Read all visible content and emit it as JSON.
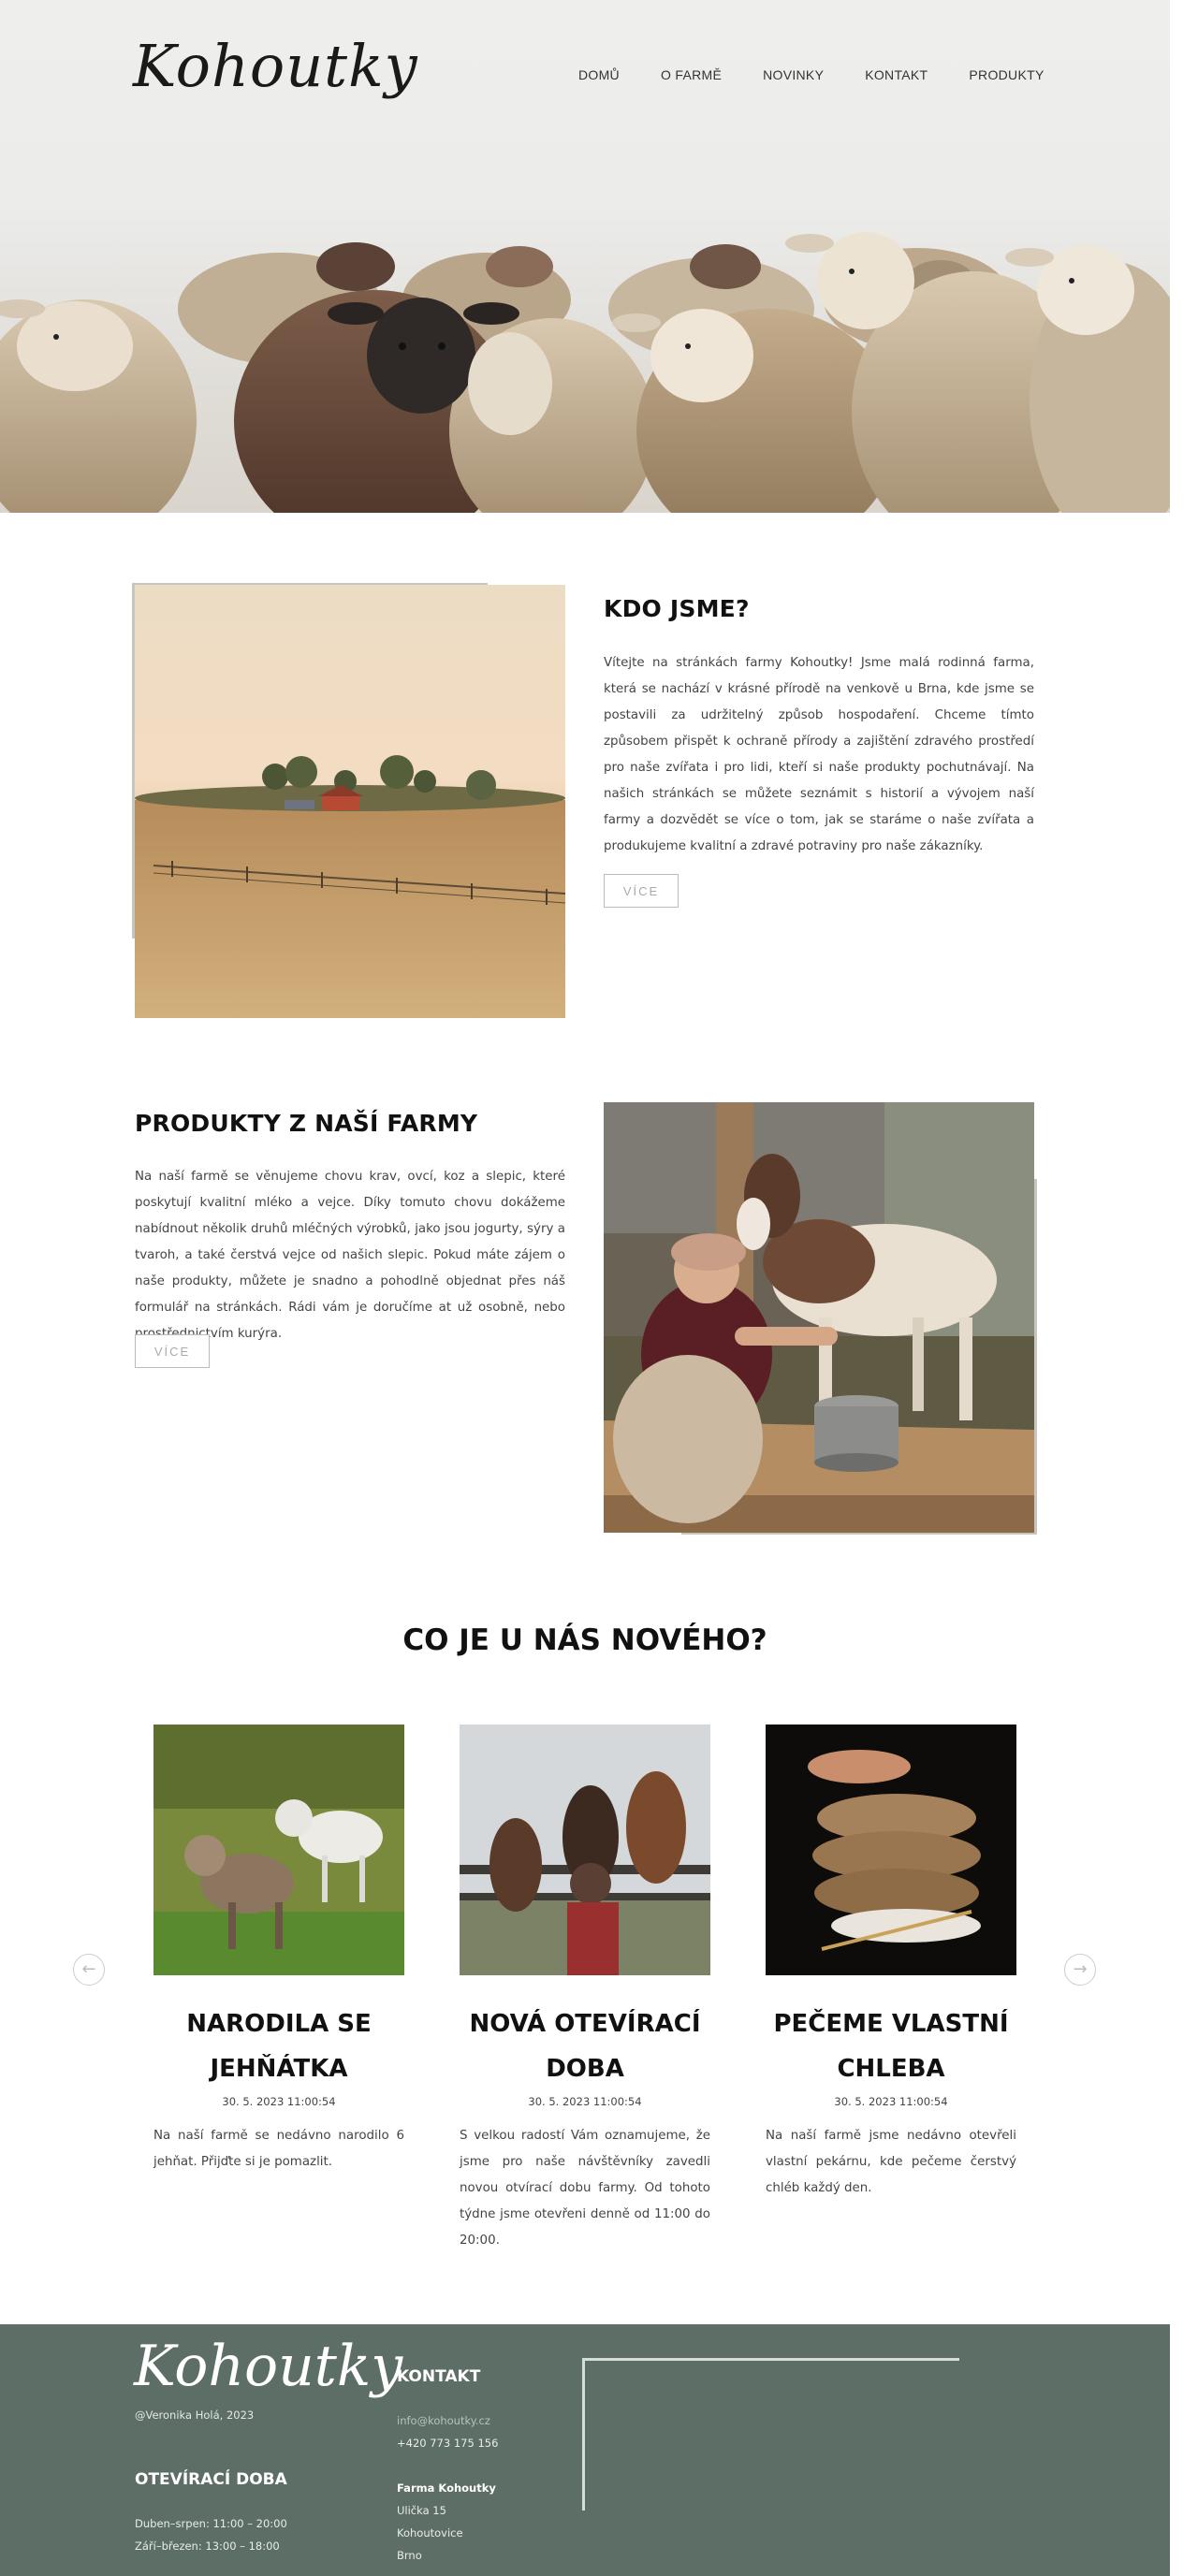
{
  "brand": {
    "logo_text": "Kohoutky"
  },
  "nav": {
    "items": [
      "DOMŮ",
      "O FARMĚ",
      "NOVINKY",
      "KONTAKT",
      "PRODUKTY"
    ]
  },
  "about": {
    "title": "KDO JSME?",
    "text": "Vítejte na stránkách farmy Kohoutky! Jsme malá rodinná farma, která se nachází v krásné přírodě na venkově u Brna, kde jsme se postavili za udržitelný způsob hospodaření. Chceme tímto způsobem přispět k ochraně přírody a zajištění zdravého prostředí pro naše zvířata i pro lidi, kteří si naše produkty pochutnávají. Na našich stránkách se můžete seznámit s historií a vývojem naší farmy a dozvědět se více o tom, jak se staráme o naše zvířata a produkujeme kvalitní a zdravé potraviny pro naše zákazníky.",
    "button": "VÍCE"
  },
  "products": {
    "title": "PRODUKTY Z NAŠÍ FARMY",
    "text": "Na naší farmě se věnujeme chovu krav, ovcí, koz a slepic, které poskytují kvalitní mléko a vejce. Díky tomuto chovu dokážeme nabídnout několik druhů mléčných výrobků, jako jsou jogurty, sýry a tvaroh, a také čerstvá vejce od našich slepic. Pokud máte zájem o naše produkty, můžete je snadno a pohodlně objednat přes náš formulář na stránkách. Rádi vám je doručíme at už osobně, nebo prostřednictvím kurýra.",
    "button": "VÍCE"
  },
  "news": {
    "title": "CO JE U NÁS NOVÉHO?",
    "prev_icon": "arrow-left-icon",
    "next_icon": "arrow-right-icon",
    "items": [
      {
        "title": "NARODILA SE JEHŇÁTKA",
        "date": "30. 5. 2023 11:00:54",
        "text": "Na naší farmě se nedávno narodilo 6 jehňat. Přijďte si je pomazlit."
      },
      {
        "title": "NOVÁ OTEVÍRACÍ DOBA",
        "date": "30. 5. 2023 11:00:54",
        "text": "S velkou radostí Vám oznamujeme, že jsme pro naše návštěvníky zavedli novou otvírací dobu farmy. Od tohoto týdne jsme otevřeni denně od 11:00 do 20:00."
      },
      {
        "title": "PEČEME VLASTNÍ CHLEBA",
        "date": "30. 5. 2023 11:00:54",
        "text": "Na naší farmě jsme nedávno otevřeli vlastní pekárnu, kde pečeme čerstvý chléb každý den."
      }
    ]
  },
  "footer": {
    "logo_text": "Kohoutky",
    "copyright": "@Veronika Holá, 2023",
    "hours_title": "OTEVÍRACÍ DOBA",
    "hours": [
      "Duben–srpen: 11:00 – 20:00",
      "Září–březen: 13:00 – 18:00"
    ],
    "contact_title": "KONTAKT",
    "email": "info@kohoutky.cz",
    "phone": "+420 773 175 156",
    "address_name": "Farma Kohoutky",
    "address_lines": [
      "Ulička 15",
      "Kohoutovice",
      "Brno"
    ]
  },
  "colors": {
    "footer_bg": "#5d6e67",
    "heading": "#111111",
    "body_text": "#444444",
    "button_border": "#bbbbbb"
  }
}
